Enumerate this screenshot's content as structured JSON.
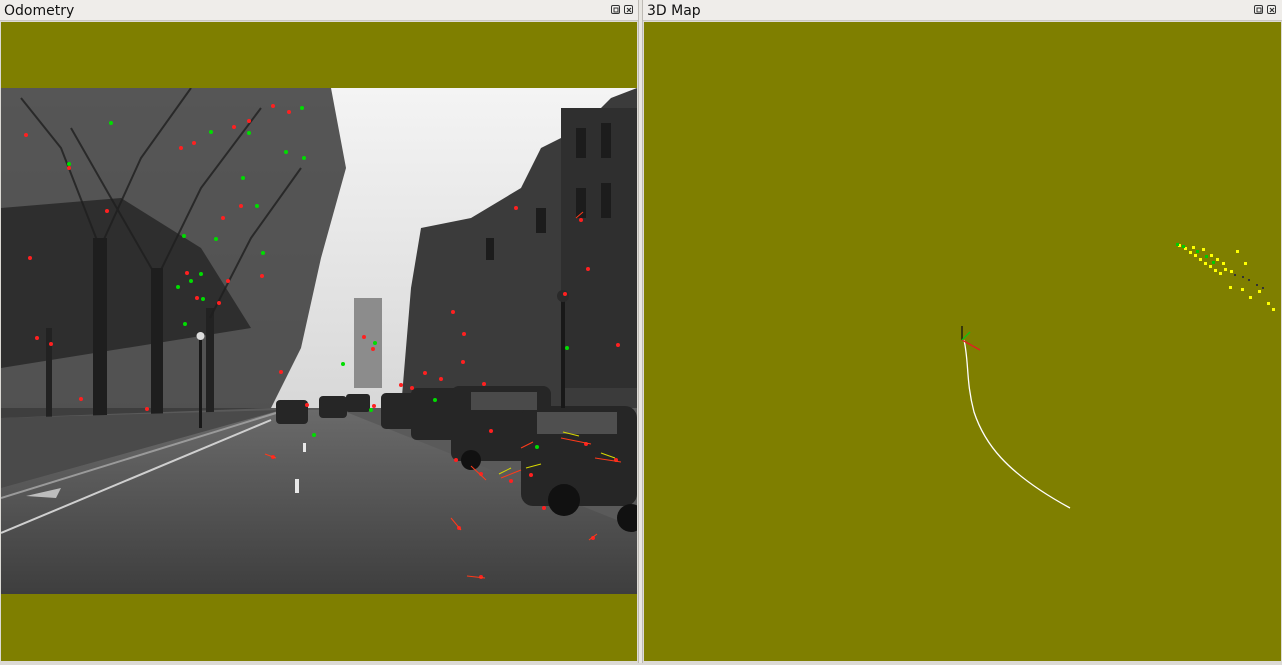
{
  "odometry": {
    "title": "Odometry",
    "buttons": {
      "float": "float",
      "close": "close"
    }
  },
  "map3d": {
    "title": "3D Map",
    "buttons": {
      "float": "float",
      "close": "close"
    }
  },
  "colors": {
    "view_background": "#7f7f00",
    "feature_inlier": "#00dd00",
    "feature_outlier": "#ff2020",
    "map_point": "#ffff00",
    "trajectory": "#ffffff"
  },
  "icons": {
    "float": "float-icon",
    "close": "close-icon"
  }
}
